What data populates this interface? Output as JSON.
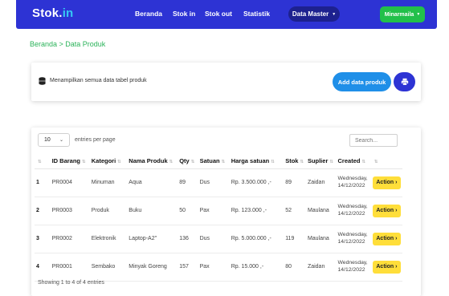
{
  "navbar": {
    "brand_main": "Stok.",
    "brand_accent": "in",
    "items": [
      "Beranda",
      "Stok in",
      "Stok out",
      "Statistik"
    ],
    "data_master": "Data Master",
    "user": "Minarmaila"
  },
  "breadcrumb": "Beranda > Data Produk",
  "info": {
    "text": "Menampilkan semua data tabel produk",
    "add_label": "Add data produk"
  },
  "table_controls": {
    "entries_value": "10",
    "entries_label": "entries per page",
    "search_placeholder": "Search..."
  },
  "table": {
    "headers": [
      "ID Barang",
      "Kategori",
      "Nama Produk",
      "Qty",
      "Satuan",
      "Harga satuan",
      "Stok",
      "Suplier",
      "Created"
    ],
    "rows": [
      {
        "no": "1",
        "id": "PR0004",
        "kategori": "Minuman",
        "nama": "Aqua",
        "qty": "89",
        "satuan": "Dus",
        "harga": "Rp. 3.500.000 ,-",
        "stok": "89",
        "suplier": "Zaidan",
        "created1": "Wednesday,",
        "created2": "14/12/2022",
        "action": "Action"
      },
      {
        "no": "2",
        "id": "PR0003",
        "kategori": "Produk",
        "nama": "Buku",
        "qty": "50",
        "satuan": "Pax",
        "harga": "Rp. 123.000 ,-",
        "stok": "52",
        "suplier": "Maulana",
        "created1": "Wednesday,",
        "created2": "14/12/2022",
        "action": "Action"
      },
      {
        "no": "3",
        "id": "PR0002",
        "kategori": "Elektronik",
        "nama": "Laptop-A2\"",
        "qty": "136",
        "satuan": "Dus",
        "harga": "Rp. 5.000.000 ,-",
        "stok": "119",
        "suplier": "Maulana",
        "created1": "Wednesday,",
        "created2": "14/12/2022",
        "action": "Action"
      },
      {
        "no": "4",
        "id": "PR0001",
        "kategori": "Sembako",
        "nama": "Minyak Goreng",
        "qty": "157",
        "satuan": "Pax",
        "harga": "Rp. 15.000 ,-",
        "stok": "80",
        "suplier": "Zaidan",
        "created1": "Wednesday,",
        "created2": "14/12/2022",
        "action": "Action"
      }
    ]
  },
  "footer": {
    "showing": "Showing 1 to 4 of 4 entries"
  },
  "colors": {
    "navbar": "#2d33d4",
    "brand_accent": "#35c9f4",
    "data_master_pill": "#1d218f",
    "user_button": "#22c04a",
    "breadcrumb": "#2bb35a",
    "add_button": "#1f8fe8",
    "action_button": "#ffde3a"
  },
  "icons": {
    "info": "database-icon",
    "print": "printer-icon",
    "dropdown": "caret-down-icon",
    "action": "chevron-right-icon",
    "sort": "sort-icon"
  }
}
